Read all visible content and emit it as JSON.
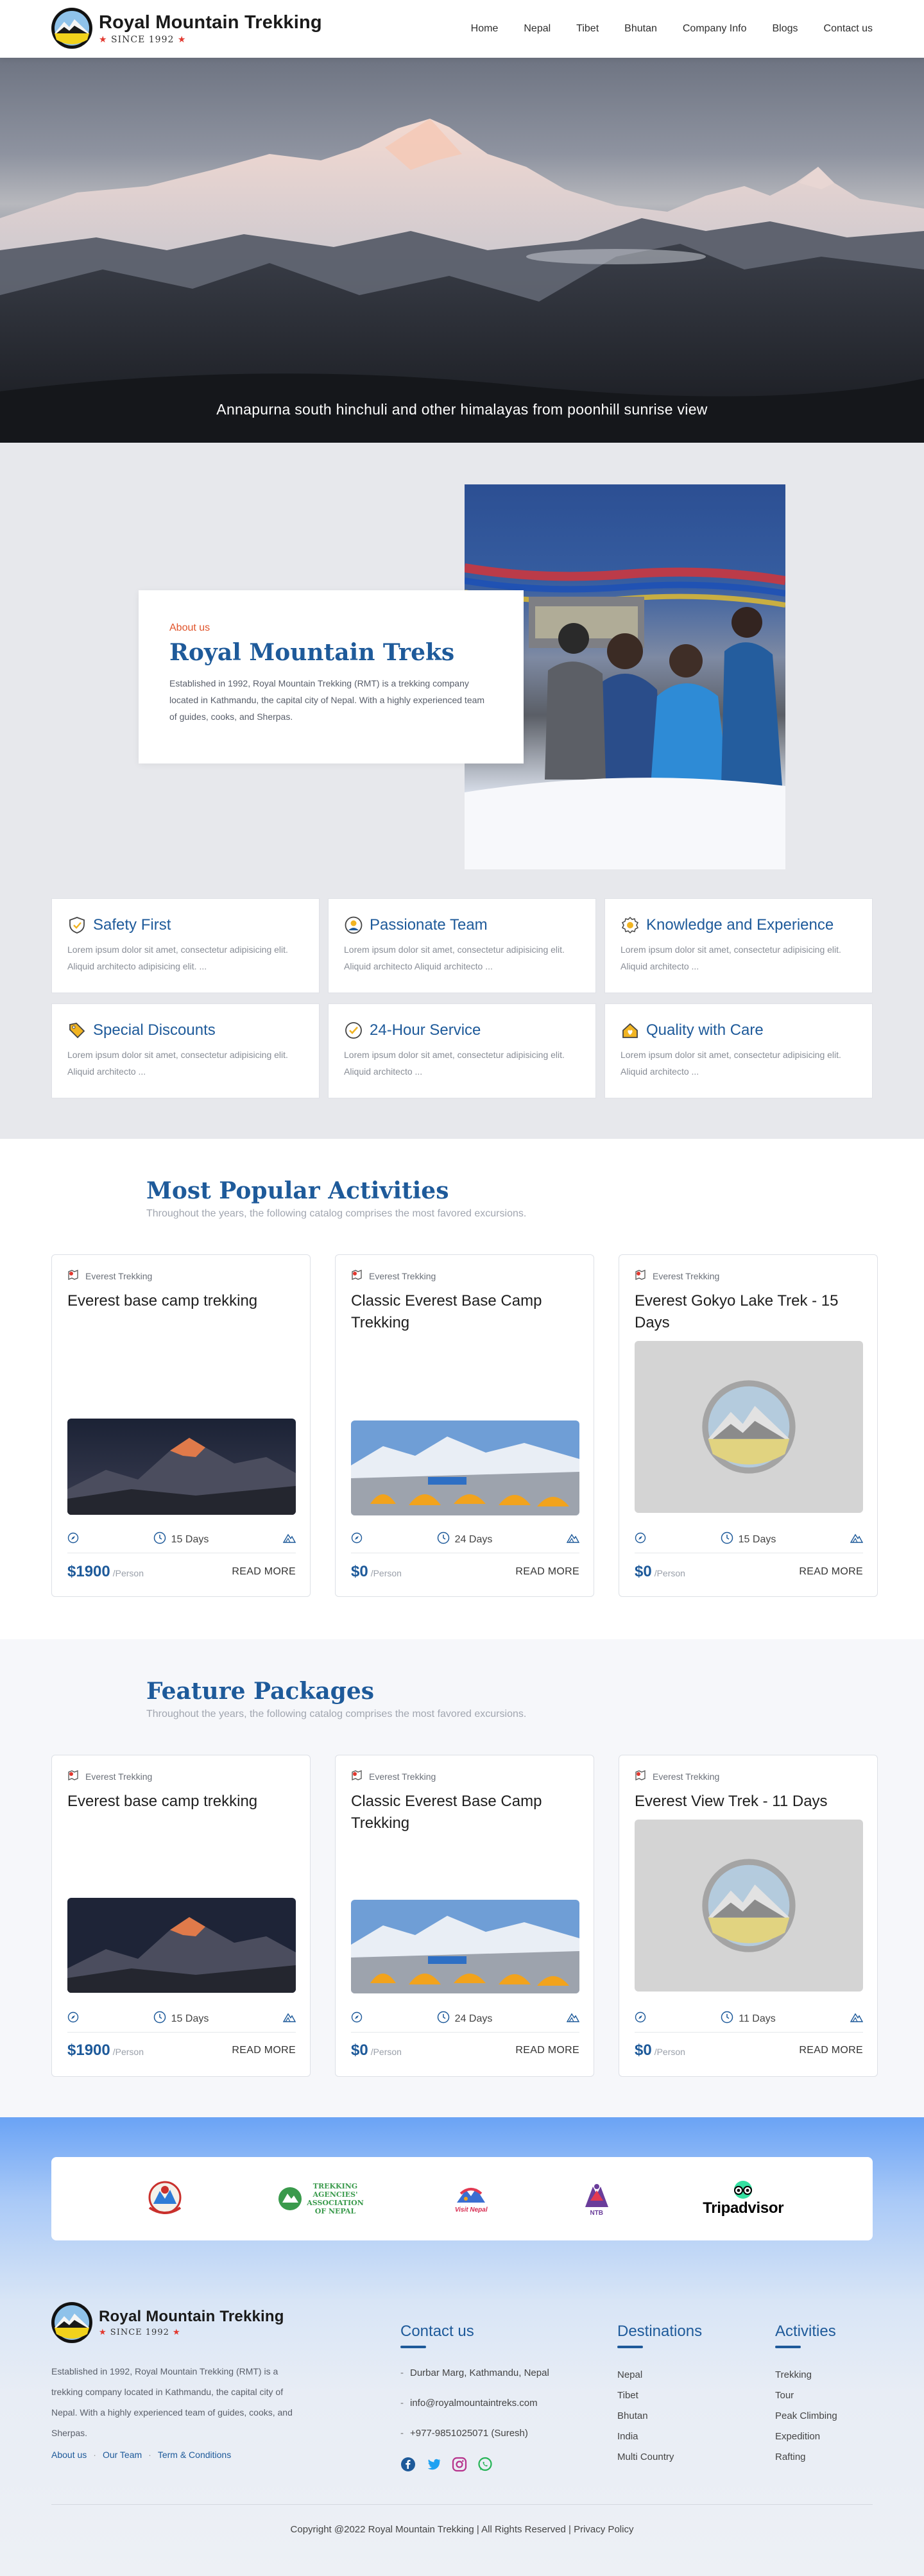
{
  "brand": {
    "name": "Royal Mountain Trekking",
    "since": "SINCE 1992"
  },
  "nav": [
    {
      "label": "Home"
    },
    {
      "label": "Nepal"
    },
    {
      "label": "Tibet"
    },
    {
      "label": "Bhutan"
    },
    {
      "label": "Company Info"
    },
    {
      "label": "Blogs"
    },
    {
      "label": "Contact us"
    }
  ],
  "hero": {
    "caption": "Annapurna south hinchuli and other himalayas from poonhill sunrise view"
  },
  "about": {
    "kicker": "About us",
    "title": "Royal Mountain Treks",
    "text": "Established in 1992, Royal Mountain Trekking (RMT) is a trekking company located in Kathmandu, the capital city of Nepal. With a highly experienced team of guides, cooks, and Sherpas."
  },
  "features": [
    {
      "icon": "shield-icon",
      "title": "Safety First",
      "desc": "Lorem ipsum dolor sit amet, consectetur adipisicing elit. Aliquid architecto adipisicing elit. ..."
    },
    {
      "icon": "team-icon",
      "title": "Passionate Team",
      "desc": "Lorem ipsum dolor sit amet, consectetur adipisicing elit. Aliquid architecto Aliquid architecto ..."
    },
    {
      "icon": "knowledge-badge-icon",
      "title": "Knowledge and Experience",
      "desc": "Lorem ipsum dolor sit amet, consectetur adipisicing elit. Aliquid architecto ..."
    },
    {
      "icon": "tag-icon",
      "title": "Special Discounts",
      "desc": "Lorem ipsum dolor sit amet, consectetur adipisicing elit. Aliquid architecto ..."
    },
    {
      "icon": "clock-check-icon",
      "title": "24-Hour Service",
      "desc": "Lorem ipsum dolor sit amet, consectetur adipisicing elit. Aliquid architecto ..."
    },
    {
      "icon": "home-heart-icon",
      "title": "Quality with Care",
      "desc": "Lorem ipsum dolor sit amet, consectetur adipisicing elit. Aliquid architecto ..."
    }
  ],
  "popular": {
    "title": "Most Popular Activities",
    "subtitle": "Throughout the years, the following catalog comprises the most favored excursions.",
    "cards": [
      {
        "category": "Everest Trekking",
        "title": "Everest base camp trekking",
        "image": "sunset-peak",
        "days": "15 Days",
        "price": "$1900",
        "per": "/Person",
        "cta": "READ MORE"
      },
      {
        "category": "Everest Trekking",
        "title": "Classic Everest Base Camp Trekking",
        "image": "base-camp-tents",
        "days": "24 Days",
        "price": "$0",
        "per": "/Person",
        "cta": "READ MORE"
      },
      {
        "category": "Everest Trekking",
        "title": "Everest Gokyo Lake Trek - 15 Days",
        "image": "placeholder-logo",
        "days": "15 Days",
        "price": "$0",
        "per": "/Person",
        "cta": "READ MORE"
      }
    ]
  },
  "packages": {
    "title": "Feature Packages",
    "subtitle": "Throughout the years, the following catalog comprises the most favored excursions.",
    "cards": [
      {
        "category": "Everest Trekking",
        "title": "Everest base camp trekking",
        "image": "sunset-peak",
        "days": "15 Days",
        "price": "$1900",
        "per": "/Person",
        "cta": "READ MORE"
      },
      {
        "category": "Everest Trekking",
        "title": "Classic Everest Base Camp Trekking",
        "image": "base-camp-tents",
        "days": "24 Days",
        "price": "$0",
        "per": "/Person",
        "cta": "READ MORE"
      },
      {
        "category": "Everest Trekking",
        "title": "Everest View Trek - 11 Days",
        "image": "placeholder-logo",
        "days": "11 Days",
        "price": "$0",
        "per": "/Person",
        "cta": "READ MORE"
      }
    ]
  },
  "partners": {
    "taan_lines": [
      "TREKKING",
      "AGENCIES'",
      "ASSOCIATION",
      "OF NEPAL"
    ],
    "visit_nepal": "Visit Nepal",
    "ntb": "NTB",
    "tripadvisor": "Tripadvisor"
  },
  "footer": {
    "about": "Established in 1992, Royal Mountain Trekking (RMT) is a trekking company located in Kathmandu, the capital city of Nepal. With a highly experienced team of guides, cooks, and Sherpas.",
    "links": [
      "About us",
      "Our Team",
      "Term & Conditions"
    ],
    "contact_title": "Contact us",
    "contact": [
      "Durbar Marg, Kathmandu, Nepal",
      "info@royalmountaintreks.com",
      "+977-9851025071 (Suresh)"
    ],
    "destinations_title": "Destinations",
    "destinations": [
      "Nepal",
      "Tibet",
      "Bhutan",
      "India",
      "Multi Country"
    ],
    "activities_title": "Activities",
    "activities": [
      "Trekking",
      "Tour",
      "Peak Climbing",
      "Expedition",
      "Rafting"
    ],
    "copyright": "Copyright @2022 Royal Mountain Trekking | All Rights Reserved | Privacy Policy"
  },
  "colors": {
    "brand_blue": "#1e5a9a",
    "accent_orange": "#e0542b",
    "star_red": "#e2382f"
  }
}
